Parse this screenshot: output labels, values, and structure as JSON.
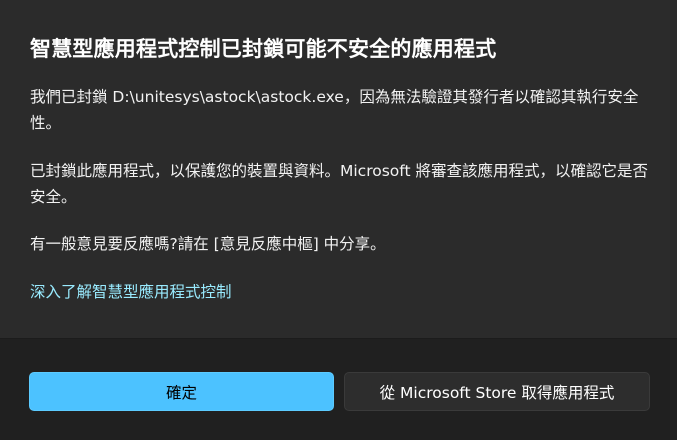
{
  "dialog": {
    "title": "智慧型應用程式控制已封鎖可能不安全的應用程式",
    "paragraph1": "我們已封鎖 D:\\unitesys\\astock\\astock.exe，因為無法驗證其發行者以確認其執行安全性。",
    "paragraph2": "已封鎖此應用程式，以保護您的裝置與資料。Microsoft 將審查該應用程式，以確認它是否安全。",
    "paragraph3": "有一般意見要反應嗎?請在 [意見反應中樞] 中分享。",
    "learn_more_link": "深入了解智慧型應用程式控制"
  },
  "footer": {
    "ok_button": "確定",
    "store_button": "從 Microsoft Store 取得應用程式"
  },
  "colors": {
    "accent": "#4cc2ff",
    "link": "#99ebff",
    "dialog_bg": "#2b2b2b",
    "footer_bg": "#202020"
  }
}
